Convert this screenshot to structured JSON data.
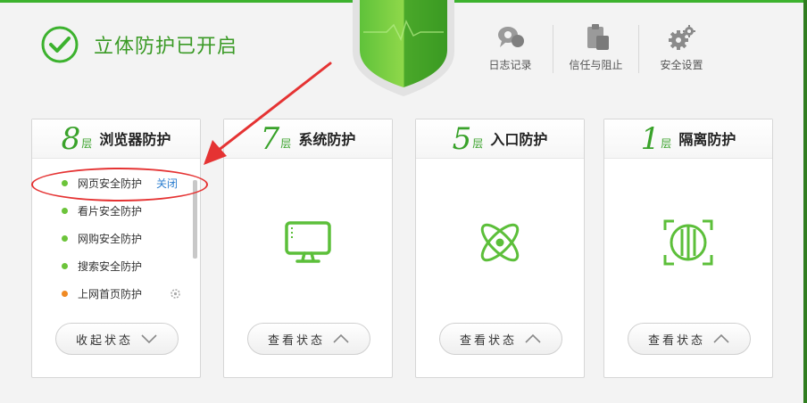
{
  "status": {
    "text": "立体防护已开启"
  },
  "tools": [
    {
      "icon": "log-icon",
      "label": "日志记录"
    },
    {
      "icon": "trust-block-icon",
      "label": "信任与阻止"
    },
    {
      "icon": "settings-gear-icon",
      "label": "安全设置"
    }
  ],
  "cards": [
    {
      "num": "8",
      "unit": "层",
      "title": "浏览器防护",
      "items": [
        {
          "label": "网页安全防护",
          "action": "关闭",
          "dot": "green"
        },
        {
          "label": "看片安全防护",
          "dot": "green"
        },
        {
          "label": "网购安全防护",
          "dot": "green"
        },
        {
          "label": "搜索安全防护",
          "dot": "green"
        },
        {
          "label": "上网首页防护",
          "dot": "orange"
        }
      ],
      "button": "收起状态"
    },
    {
      "num": "7",
      "unit": "层",
      "title": "系统防护",
      "icon": "monitor-icon",
      "button": "查看状态"
    },
    {
      "num": "5",
      "unit": "层",
      "title": "入口防护",
      "icon": "atom-icon",
      "button": "查看状态"
    },
    {
      "num": "1",
      "unit": "层",
      "title": "隔离防护",
      "icon": "isolation-icon",
      "button": "查看状态"
    }
  ],
  "colors": {
    "accent": "#3cb22e",
    "link": "#2e7fd0",
    "annotation": "#e53333"
  }
}
